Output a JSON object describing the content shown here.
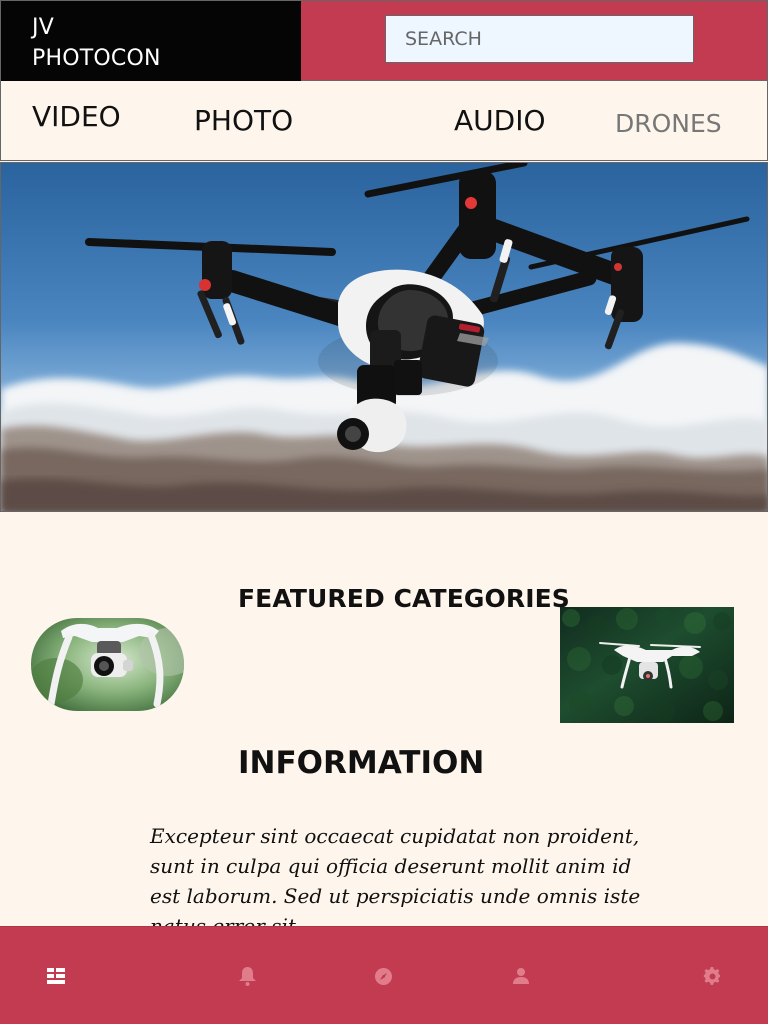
{
  "header": {
    "brand_line_1": "JV",
    "brand_line_2": "PHOTOCON",
    "search_placeholder": "SEARCH"
  },
  "tabs": [
    {
      "label": "VIDEO"
    },
    {
      "label": "PHOTO"
    },
    {
      "label": "AUDIO"
    },
    {
      "label": "DRONES"
    }
  ],
  "main": {
    "featured_title": "FEATURED CATEGORIES",
    "information_title": "INFORMATION",
    "information_text": "Excepteur sint occaecat cupidatat non proident, sunt in culpa qui officia deserunt mollit anim id est laborum. Sed ut perspiciatis unde omnis iste natus error sit"
  },
  "bottom_nav": {
    "items": [
      {
        "icon": "grid-icon"
      },
      {
        "icon": "bell-icon"
      },
      {
        "icon": "compass-icon"
      },
      {
        "icon": "user-icon"
      },
      {
        "icon": "gear-icon"
      }
    ]
  },
  "colors": {
    "brand_bg": "#050505",
    "accent": "#c23b50",
    "page_bg": "#fef6ec",
    "search_bg": "#eef7ff"
  }
}
